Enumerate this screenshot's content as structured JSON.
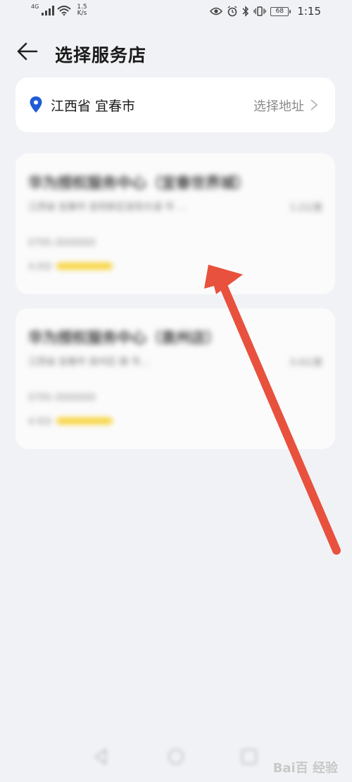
{
  "status_bar": {
    "network": "4G",
    "speed_value": "1.5",
    "speed_unit": "K/s",
    "battery": "68",
    "time": "1:15"
  },
  "header": {
    "title": "选择服务店"
  },
  "location": {
    "region": "江西省 宜春市",
    "select_label": "选择地址"
  },
  "stores": [
    {
      "name": "华为授权服务中心（宜春世界城）",
      "address": "江西省 宜春市 宜阳新区宜阳大道 号 …",
      "distance": "1.2公里",
      "phone": "0795-3000000",
      "score": "4.9分"
    },
    {
      "name": "华为授权服务中心（袁州店）",
      "address": "江西省 宜春市 袁州区 路 号…",
      "distance": "3.4公里",
      "phone": "0795-3000000",
      "score": "4.9分"
    }
  ],
  "watermark": "Bai百 经验"
}
